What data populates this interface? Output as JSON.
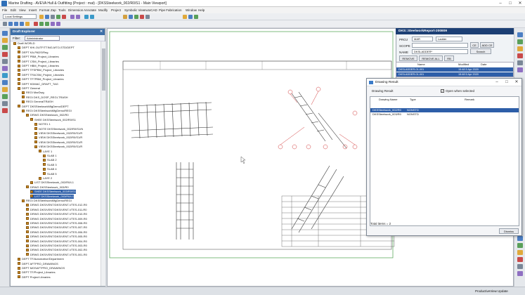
{
  "window": {
    "title": "Marine Drafting - AVEVA Hull & Outfitting (Project : mat) - [DKSSteelwork_002/R0/S1 - Main Viewport]",
    "min": "–",
    "max": "□",
    "close": "✕"
  },
  "menu": [
    "File",
    "Edit",
    "View",
    "Insert",
    "Format",
    "Zap",
    "Tools",
    "Dimension",
    "Annotate",
    "Modify",
    "Project",
    "Symbolic View",
    "AutoCAD",
    "Pipe Fabrication",
    "Window",
    "Help"
  ],
  "toolbar": {
    "settings_combo": "Local Settings"
  },
  "explorer": {
    "header": "Draft Explorer",
    "filter_label": "Filter:",
    "filter_value": "Administrator",
    "rows": [
      {
        "d": 0,
        "t": "Draft WORLD"
      },
      {
        "d": 1,
        "t": "DEPT KHI-OUTFITTING-MTO-STD/DEPT"
      },
      {
        "d": 1,
        "t": "DEPT KA-PADS/Reg"
      },
      {
        "d": 1,
        "t": "DEPT PBM_Project_Libraries"
      },
      {
        "d": 1,
        "t": "DEPT CSM_Project_Libraries"
      },
      {
        "d": 1,
        "t": "DEPT HBM_Project_Libraries"
      },
      {
        "d": 1,
        "t": "DEPT TFSPBM_Project_Libraries"
      },
      {
        "d": 1,
        "t": "DEPT TFACSM_Project_Libraries"
      },
      {
        "d": 1,
        "t": "DEPT TF7PBM_Project_Libraries"
      },
      {
        "d": 1,
        "t": "DEPT KDMAC_DRAFT_TAG"
      },
      {
        "d": 1,
        "t": "DEPT General"
      },
      {
        "d": 2,
        "t": "REGI MarDwg"
      },
      {
        "d": 2,
        "t": "REGI DKS_DOSP_REGI-TRASH"
      },
      {
        "d": 2,
        "t": "REGI GeneralTRASH"
      },
      {
        "d": 1,
        "t": "DEPT DKSSteelworkMfgDemo/DEPT"
      },
      {
        "d": 2,
        "t": "REGI DKSSteelworkMfgDemo/REGI"
      },
      {
        "d": 3,
        "t": "DRWG DKSSteelwork_002/R0"
      },
      {
        "d": 4,
        "t": "SHEE DKSSteelwork_002/R0/S1"
      },
      {
        "d": 5,
        "t": "NOTE1 1"
      },
      {
        "d": 5,
        "t": "NOTE DKSSteelwork_002/R0/S1/N"
      },
      {
        "d": 5,
        "t": "VIEW DKSSteelwork_002/R0/S1/R"
      },
      {
        "d": 5,
        "t": "VIEW DKSSteelwork_002/R0/S1/R"
      },
      {
        "d": 5,
        "t": "VIEW DKSSteelwork_002/R0/S1/R"
      },
      {
        "d": 5,
        "t": "VIEW DKSSteelwork_002/R0/S1/R"
      },
      {
        "d": 6,
        "t": "LAYE 1"
      },
      {
        "d": 7,
        "t": "SLAB 1"
      },
      {
        "d": 7,
        "t": "SLAB 2"
      },
      {
        "d": 7,
        "t": "SLAB 3"
      },
      {
        "d": 7,
        "t": "SLAB 4"
      },
      {
        "d": 7,
        "t": "SLAB 5"
      },
      {
        "d": 6,
        "t": "LAYE 2"
      },
      {
        "d": 4,
        "t": "LIST DKSSteelwork_002/R0/L1"
      },
      {
        "d": 3,
        "t": "DRWG DKSSteelwork_003/R0"
      },
      {
        "d": 4,
        "t": "SHEE DKSSteelwork_003/R0/S1",
        "sel": true
      },
      {
        "d": 4,
        "t": "LIST DKSSteelwork_003/R0/L1",
        "sel": true
      },
      {
        "d": 2,
        "t": "REGI DKSSteelworkMfgDemo/REGI"
      },
      {
        "d": 3,
        "t": "DRWG DKS/VENT/DKS/VENT-VTES-012-R0"
      },
      {
        "d": 3,
        "t": "DRWG DKS/VENT/DKS/VENT-VTES-011-R0"
      },
      {
        "d": 3,
        "t": "DRWG DKS/VENT/DKS/VENT-VTES-010-R0"
      },
      {
        "d": 3,
        "t": "DRWG DKS/VENT/DKS/VENT-VTES-009-R0"
      },
      {
        "d": 3,
        "t": "DRWG DKS/VENT/DKS/VENT-VTES-008-R0"
      },
      {
        "d": 3,
        "t": "DRWG DKS/VENT/DKS/VENT-VTES-007-R0"
      },
      {
        "d": 3,
        "t": "DRWG DKS/VENT/DKS/VENT-VTES-006-R0"
      },
      {
        "d": 3,
        "t": "DRWG DKS/VENT/DKS/VENT-VTES-005-R0"
      },
      {
        "d": 3,
        "t": "DRWG DKS/VENT/DKS/VENT-VTES-004-R0"
      },
      {
        "d": 3,
        "t": "DRWG DKS/VENT/DKS/VENT-VTES-003-R0"
      },
      {
        "d": 3,
        "t": "DRWG DKS/VENT/DKS/VENT-VTES-002-R0"
      },
      {
        "d": 3,
        "t": "DRWG DKS/VENT/DKS/VENT-VTES-001-R0"
      },
      {
        "d": 1,
        "t": "DEPT TF/Automotive/Department"
      },
      {
        "d": 1,
        "t": "DEPT AFTPRO_DRAWINGS"
      },
      {
        "d": 1,
        "t": "DEPT MOSAFTPRO_DRAWINGS"
      },
      {
        "d": 1,
        "t": "DEPT TF/Project_Libraries"
      },
      {
        "d": 1,
        "t": "DEPT Project Libraries"
      }
    ]
  },
  "explorer_panel": {
    "title": "DKS::SteelworkReport-200809",
    "proj_label": "PROJ",
    "proj_value": "MAR",
    "proj_type": "Ladder",
    "scope_label": "SCOPE",
    "name_label": "NAME",
    "name_value": "DKSLADDER*",
    "ce_btn": "CE",
    "add_ce_btn": "ADD CE",
    "search_btn": "Search",
    "remove_btn": "REMOVE",
    "remove_all_btn": "REMOVE ALL",
    "rb_btn": "RB",
    "columns": [
      "Name",
      "Modified",
      "Date"
    ],
    "rows": [
      {
        "name": "DKSLADDER-01-001",
        "mod": "15:48 5 Apr 2020"
      },
      {
        "name": "DKSLADDER-01-001",
        "mod": "15:48 5 Apr 2020"
      }
    ]
  },
  "dialog": {
    "title": "Drawing Result",
    "result_label": "Drawing Result",
    "open_label": "Open when selected",
    "columns": [
      "Drawing Name",
      "Type",
      "Remark"
    ],
    "rows": [
      {
        "name": "DKSSteelwork_002/R0",
        "type": "NONSTD",
        "remark": ""
      },
      {
        "name": "DKSSteelwork_003/R0",
        "type": "NONSTD",
        "remark": ""
      }
    ],
    "total": "Total items = 2",
    "dismiss": "Dismiss",
    "min": "–",
    "max": "□",
    "close": "✕"
  },
  "status": {
    "right": "ProductiveView  Update"
  },
  "colors": {
    "accent": "#2d5ea8",
    "panel_header": "#1c3f74",
    "draw_red": "#d23a3a",
    "frame_green": "#4aa04a"
  }
}
